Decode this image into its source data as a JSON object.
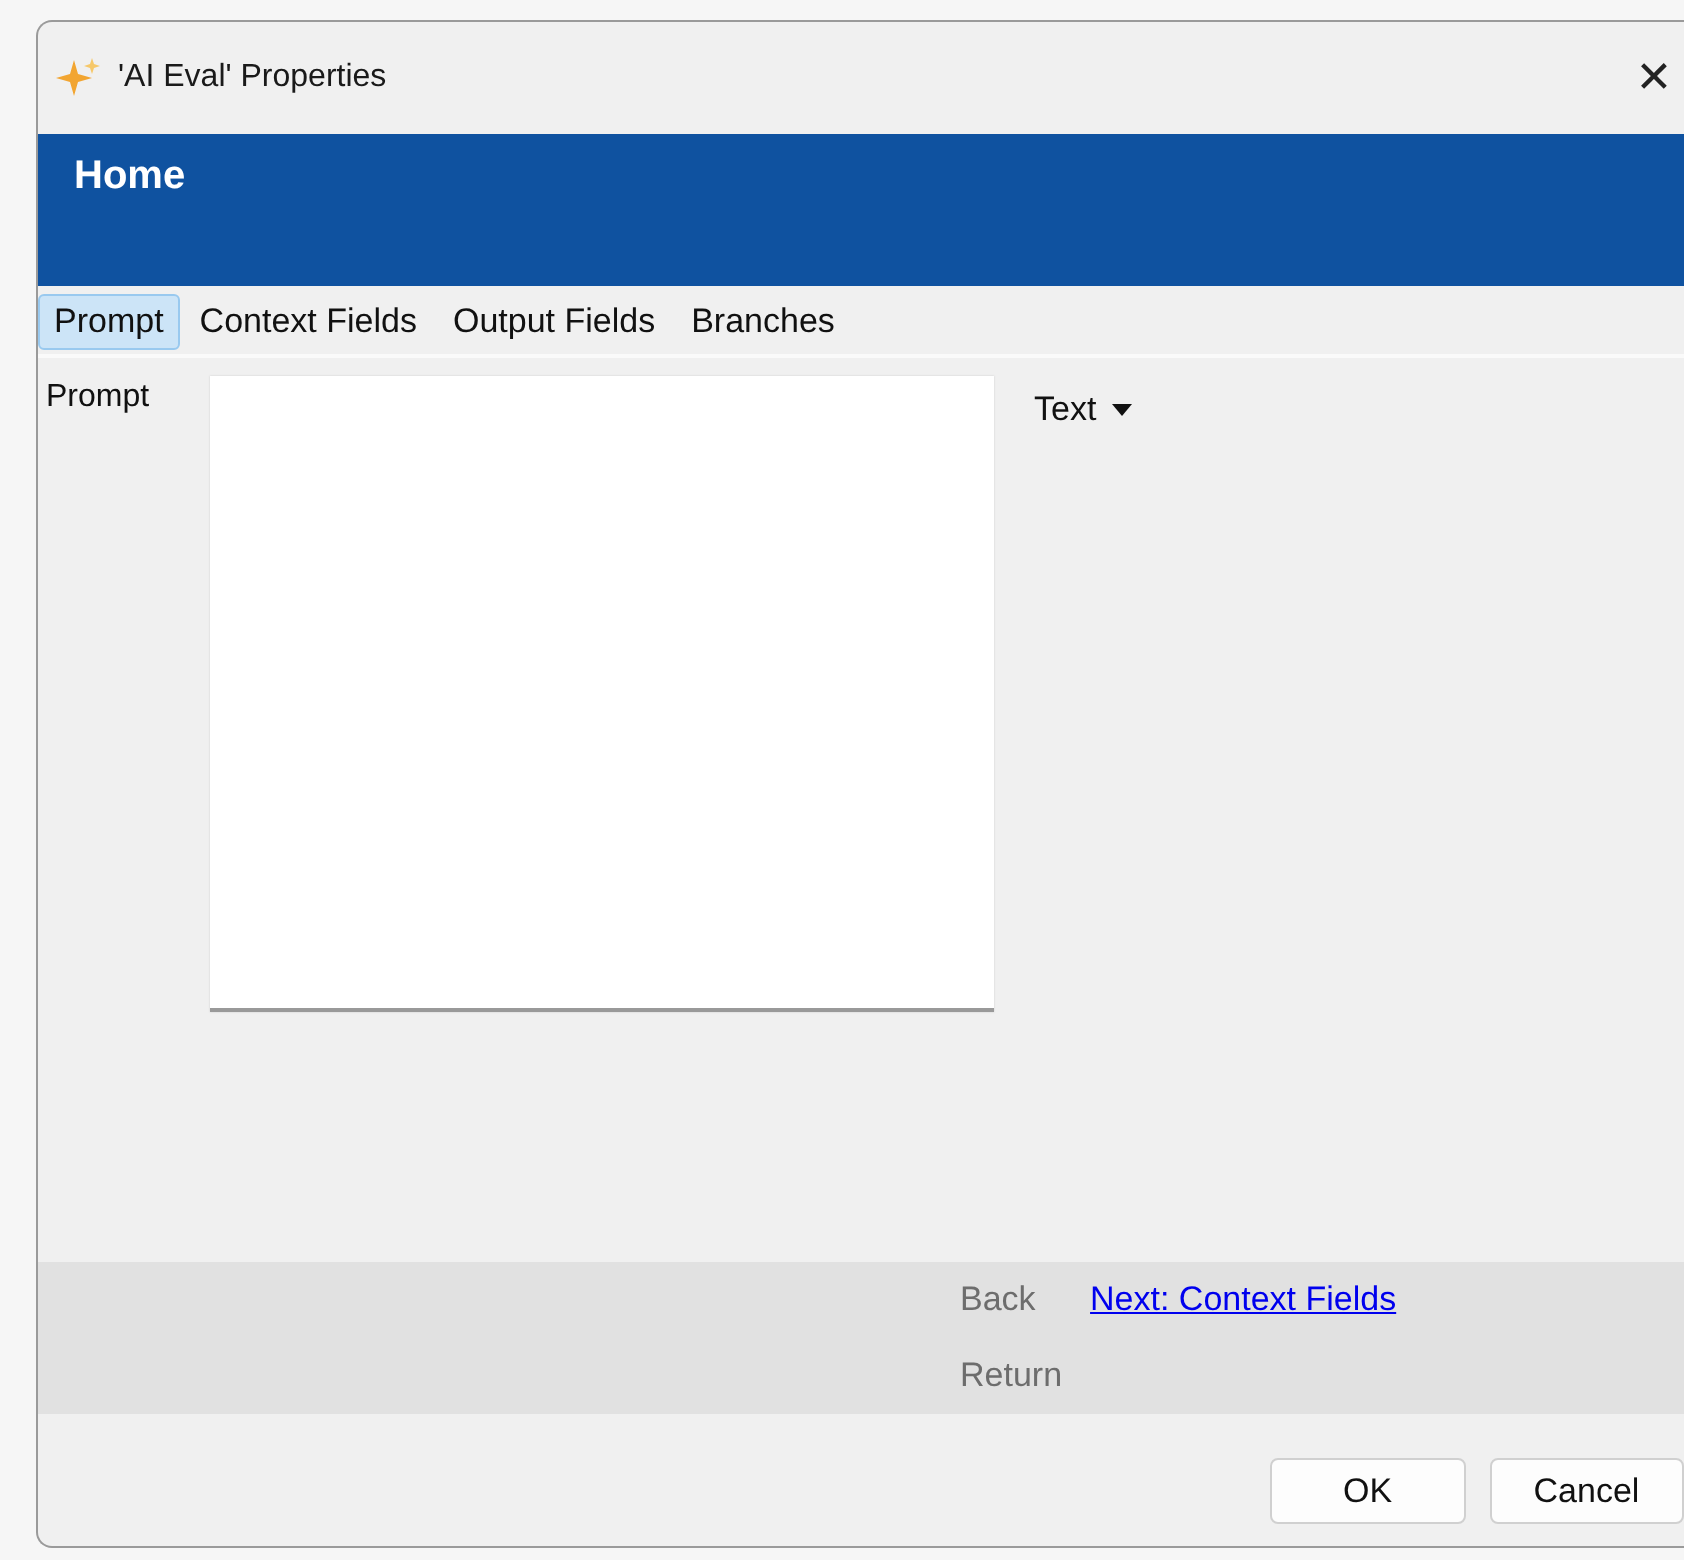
{
  "window": {
    "title": "'AI Eval' Properties",
    "close": "✕"
  },
  "header": {
    "title": "Home"
  },
  "tabs": [
    {
      "label": "Prompt",
      "selected": true
    },
    {
      "label": "Context Fields",
      "selected": false
    },
    {
      "label": "Output Fields",
      "selected": false
    },
    {
      "label": "Branches",
      "selected": false
    }
  ],
  "prompt": {
    "label": "Prompt",
    "format": "Text"
  },
  "navigation": [
    {
      "label": "Back",
      "kind": "button",
      "disabled": true
    },
    {
      "label": "Next: Context Fields",
      "kind": "link",
      "disabled": false
    },
    {
      "label": "Return",
      "kind": "button",
      "disabled": true
    }
  ],
  "buttons": [
    "OK",
    "Cancel"
  ]
}
